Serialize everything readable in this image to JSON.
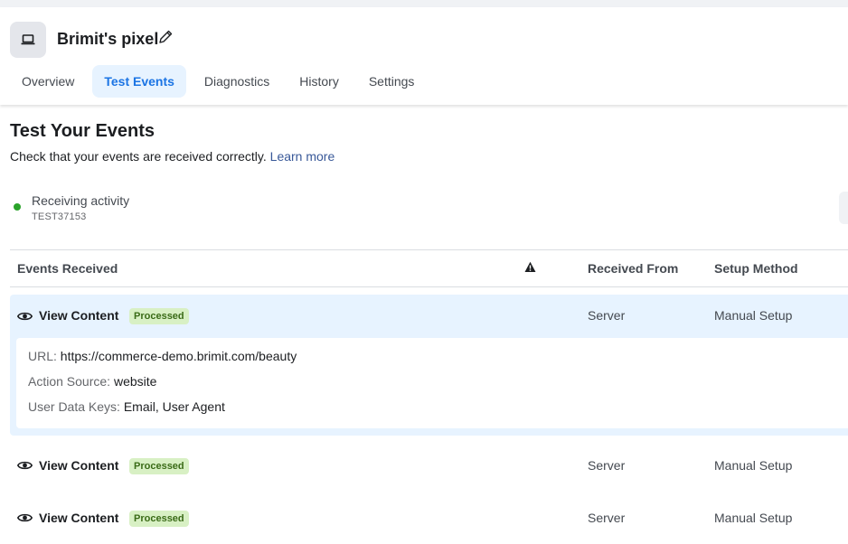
{
  "header": {
    "title": "Brimit's pixel",
    "tabs": [
      {
        "label": "Overview"
      },
      {
        "label": "Test Events"
      },
      {
        "label": "Diagnostics"
      },
      {
        "label": "History"
      },
      {
        "label": "Settings"
      }
    ],
    "active_tab": "Test Events"
  },
  "main": {
    "title": "Test Your Events",
    "subtitle": "Check that your events are received correctly.",
    "learn_more": "Learn more",
    "status": {
      "label": "Receiving activity",
      "code": "TEST37153",
      "color": "#2aa32a"
    }
  },
  "table": {
    "columns": {
      "events": "Events Received",
      "received_from": "Received From",
      "setup_method": "Setup Method"
    },
    "rows": [
      {
        "name": "View Content",
        "badge": "Processed",
        "received_from": "Server",
        "setup_method": "Manual Setup",
        "expanded": true,
        "details": [
          {
            "key": "URL:",
            "value": "https://commerce-demo.brimit.com/beauty"
          },
          {
            "key": "Action Source:",
            "value": "website"
          },
          {
            "key": "User Data Keys:",
            "value": "Email, User Agent"
          }
        ]
      },
      {
        "name": "View Content",
        "badge": "Processed",
        "received_from": "Server",
        "setup_method": "Manual Setup"
      },
      {
        "name": "View Content",
        "badge": "Processed",
        "received_from": "Server",
        "setup_method": "Manual Setup"
      }
    ]
  },
  "colors": {
    "accent": "#1b74e4",
    "link": "#385898",
    "badge_bg": "#d8f0c4",
    "badge_text": "#3a6b17",
    "expanded_bg": "#e7f3ff"
  },
  "icons": {
    "pixel": "laptop-icon",
    "edit": "pencil-icon",
    "warning": "warning-icon",
    "view": "eye-icon"
  }
}
